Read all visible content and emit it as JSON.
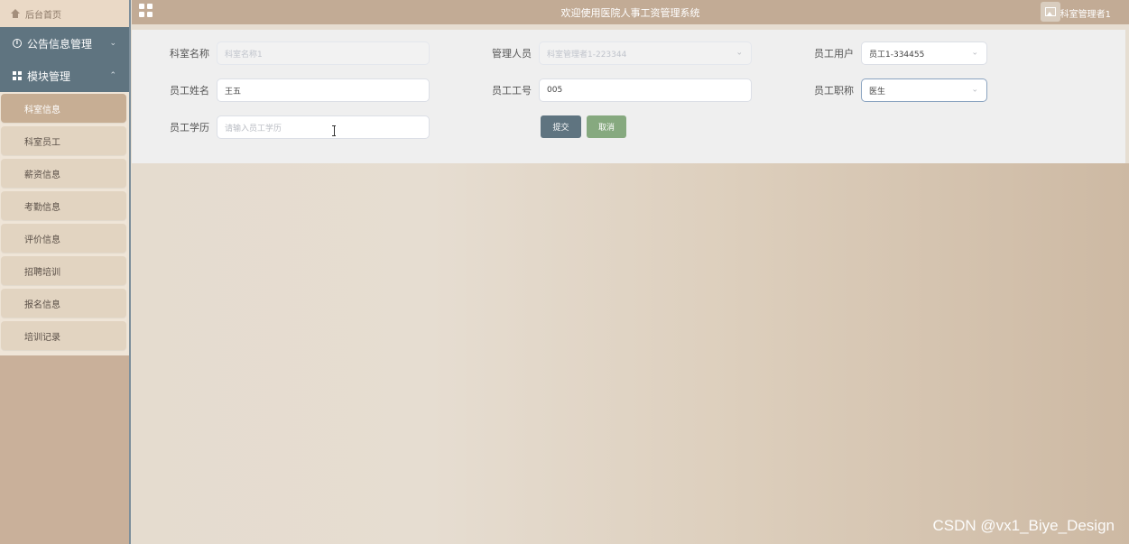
{
  "sidebar": {
    "home_label": "后台首页",
    "groups": [
      {
        "label": "公告信息管理",
        "expanded": false
      },
      {
        "label": "模块管理",
        "expanded": true
      }
    ],
    "items": [
      {
        "label": "科室信息",
        "active": true
      },
      {
        "label": "科室员工",
        "active": false
      },
      {
        "label": "薪资信息",
        "active": false
      },
      {
        "label": "考勤信息",
        "active": false
      },
      {
        "label": "评价信息",
        "active": false
      },
      {
        "label": "招聘培训",
        "active": false
      },
      {
        "label": "报名信息",
        "active": false
      },
      {
        "label": "培训记录",
        "active": false
      }
    ]
  },
  "topbar": {
    "title": "欢迎使用医院人事工资管理系统",
    "user": "科室管理者1"
  },
  "form": {
    "dept_name": {
      "label": "科室名称",
      "value": "科室名称1"
    },
    "manager": {
      "label": "管理人员",
      "value": "科室管理者1-223344"
    },
    "employee_user": {
      "label": "员工用户",
      "value": "员工1-334455"
    },
    "employee_name": {
      "label": "员工姓名",
      "value": "王五"
    },
    "employee_no": {
      "label": "员工工号",
      "value": "005"
    },
    "employee_title": {
      "label": "员工职称",
      "value": "医生"
    },
    "employee_edu": {
      "label": "员工学历",
      "placeholder": "请输入员工学历"
    },
    "submit_label": "提交",
    "cancel_label": "取消"
  },
  "watermark": "CSDN @vx1_Biye_Design",
  "colors": {
    "sidebar_group": "#5f7480",
    "active_item": "#c7ae94",
    "topbar": "#c2ab95",
    "submit": "#5f7480",
    "cancel": "#86a97f"
  },
  "icons": {
    "home": "home-icon",
    "info": "info-circle-icon",
    "module": "grid-icon",
    "apps": "apps-icon",
    "avatar": "image-icon",
    "chevron": "chevron-icon"
  }
}
